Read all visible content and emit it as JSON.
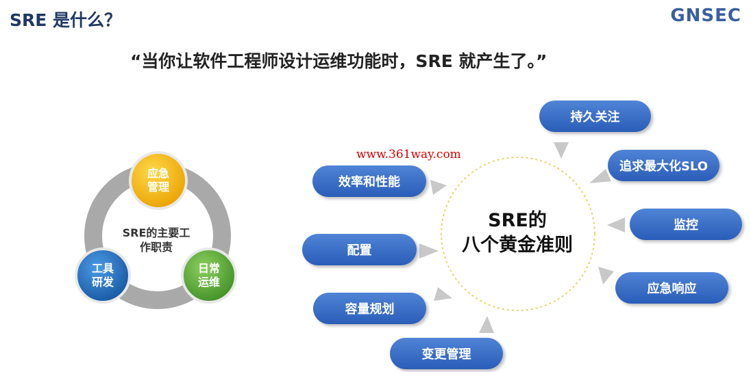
{
  "header": {
    "title": "SRE 是什么？",
    "brand": "GNSEC"
  },
  "quote": "“当你让软件工程师设计运维功能时，SRE 就产生了。”",
  "watermark": "www.361way.com",
  "duties_cycle": {
    "center": [
      "SRE的主要工",
      "作职责"
    ],
    "items": [
      {
        "lines": [
          "应急",
          "管理"
        ],
        "color": "#f2b200"
      },
      {
        "lines": [
          "日常",
          "运维"
        ],
        "color": "#5aa63a"
      },
      {
        "lines": [
          "工具",
          "研发"
        ],
        "color": "#1f6ec0"
      }
    ]
  },
  "principles": {
    "center": [
      "SRE的",
      "八个黄金准则"
    ],
    "items": [
      "持久关注",
      "追求最大化SLO",
      "监控",
      "应急响应",
      "变更管理",
      "容量规划",
      "配置",
      "效率和性能"
    ]
  }
}
